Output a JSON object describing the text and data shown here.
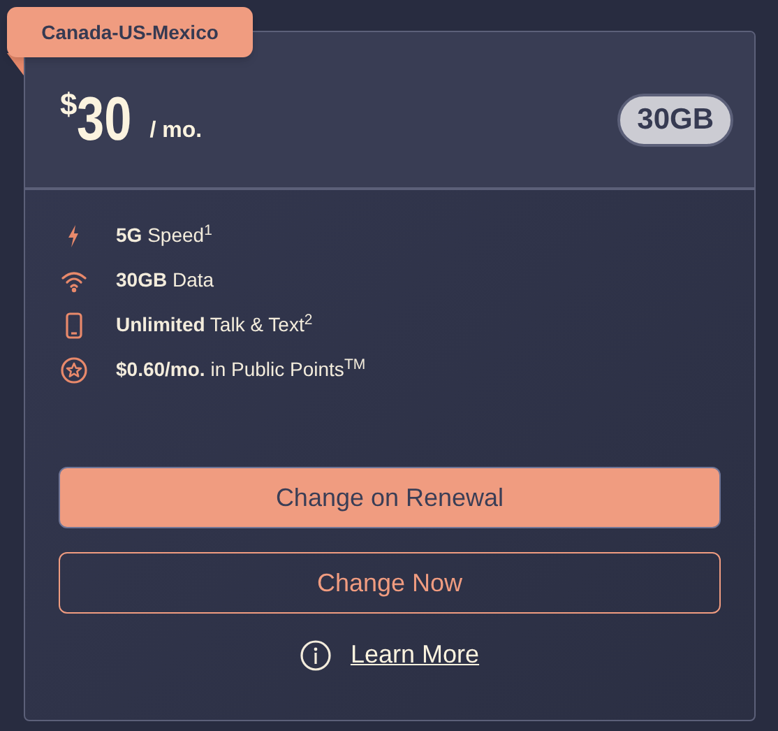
{
  "plan": {
    "region": "Canada-US-Mexico",
    "currency": "$",
    "price": "30",
    "period": "/ mo.",
    "data_badge": "30GB"
  },
  "features": [
    {
      "kind": "speed",
      "text": "**5G** Speed$^{1}$"
    },
    {
      "kind": "data",
      "text": "**30GB** Data"
    },
    {
      "kind": "talk",
      "text": "**Unlimited** Talk & Text$^{2}$"
    },
    {
      "kind": "points",
      "text": "**$0.60/mo.** in Public Points$^{TM}$"
    }
  ],
  "buttons": [
    {
      "kind": "filled",
      "label": "Change on Renewal"
    },
    {
      "kind": "outline",
      "label": "Change Now"
    }
  ],
  "link": {
    "label": "Learn More"
  }
}
